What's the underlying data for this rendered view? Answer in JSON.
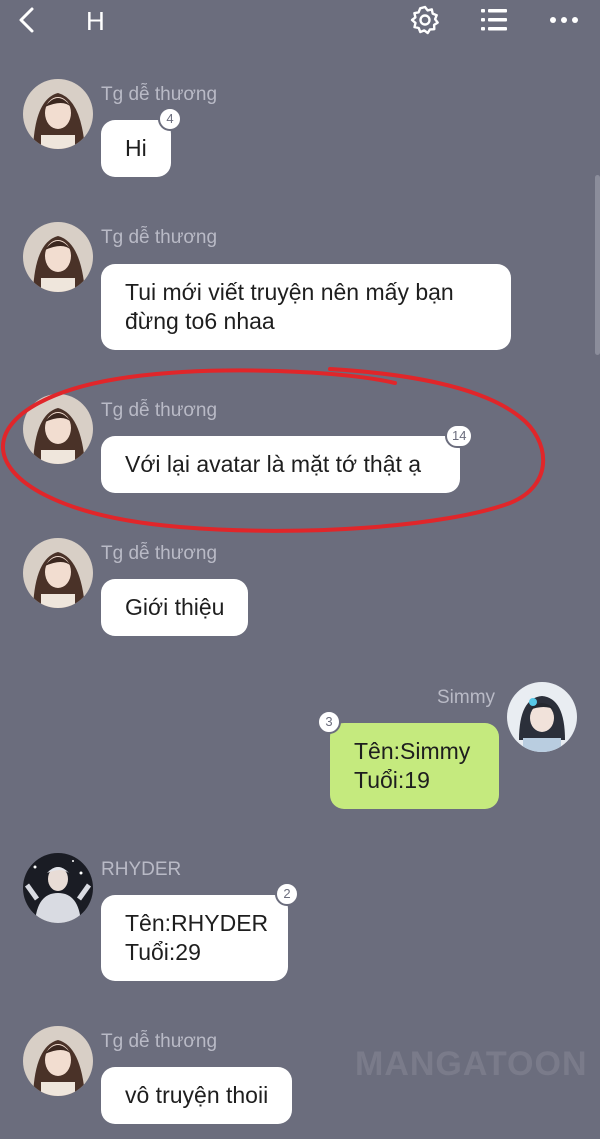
{
  "header": {
    "title": "H",
    "back_icon": "chevron-left-icon",
    "settings_icon": "gear-icon",
    "list_icon": "list-icon",
    "more_icon": "more-dots-icon"
  },
  "messages": [
    {
      "sender": "Tg dễ thương",
      "text": "Hi",
      "badge": "4",
      "side": "left"
    },
    {
      "sender": "Tg dễ thương",
      "text": "Tui mới viết truyện nên mấy bạn\nđừng to6 nhaa",
      "badge": "",
      "side": "left"
    },
    {
      "sender": "Tg dễ thương",
      "text": "Với lại avatar là mặt tớ thật ạ",
      "badge": "14",
      "side": "left"
    },
    {
      "sender": "Tg dễ thương",
      "text": "Giới thiệu",
      "badge": "",
      "side": "left"
    },
    {
      "sender": "Simmy",
      "text": "Tên:Simmy\nTuổi:19",
      "badge": "3",
      "side": "right"
    },
    {
      "sender": "RHYDER",
      "text": "Tên:RHYDER\nTuổi:29",
      "badge": "2",
      "side": "left"
    },
    {
      "sender": "Tg dễ thương",
      "text": "vô truyện thoii",
      "badge": "",
      "side": "left"
    }
  ],
  "watermark": "MANGATOON",
  "colors": {
    "background": "#6b6d7d",
    "bubble": "#ffffff",
    "bubble_self": "#c5ea7e",
    "annotation": "#e0262a"
  }
}
